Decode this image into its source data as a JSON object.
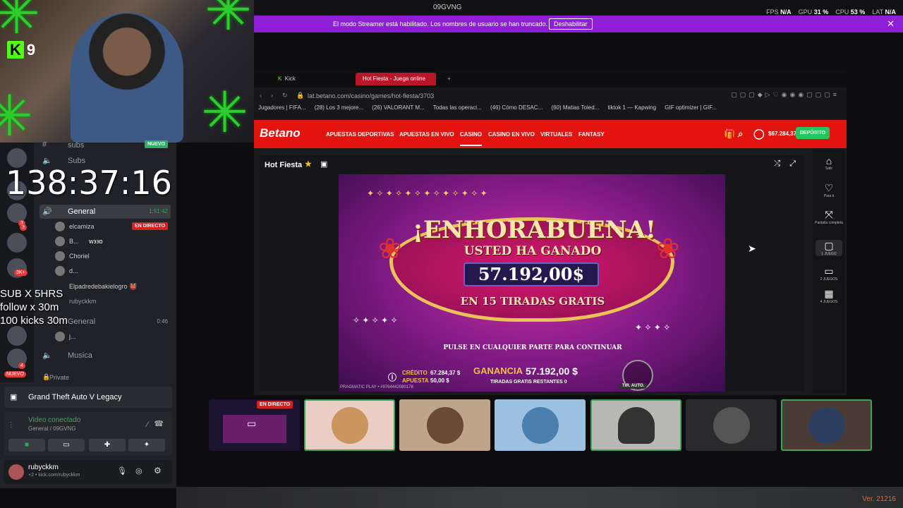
{
  "topbar": {
    "center_title": "09GVNG",
    "fps_label": "FPS",
    "fps_value": "N/A",
    "gpu_label": "GPU",
    "gpu_value": "31 %",
    "cpu_label": "CPU",
    "cpu_value": "53 %",
    "lat_label": "LAT",
    "lat_value": "N/A"
  },
  "streamer_bar": {
    "message": "El modo Streamer está habilitado. Los nombres de usuario se han truncado.",
    "button": "Deshabilitar",
    "close": "✕"
  },
  "webcam": {
    "kick_count": "9"
  },
  "overlay": {
    "timer": "138:37:16",
    "lines": [
      "SUB X 5HRS",
      "follow x 30m",
      "100 kicks 30m"
    ]
  },
  "discord": {
    "server_badges": [
      "3",
      "3K+",
      "NUEVO",
      "3",
      "4"
    ],
    "channels": [
      {
        "name": "subs",
        "badge": "NUEVO"
      },
      {
        "name": "Subs"
      },
      {
        "name": "General",
        "time": "1:51:42"
      }
    ],
    "members": [
      {
        "name": "elcamiza",
        "live": "EN DIRECTO"
      },
      {
        "name": "B...",
        "extra": "w϶϶ɒ"
      },
      {
        "name": "Choriel"
      },
      {
        "name": "d..."
      },
      {
        "name": "Elpadredebakielogro 👹"
      },
      {
        "name": "rubyckkm"
      }
    ],
    "channel_general2": {
      "name": "General",
      "time": "0:46"
    },
    "member_j": "j...",
    "channel_musica": "Musica",
    "private": "Private",
    "game_activity": "Grand Theft Auto V Legacy",
    "voice": {
      "status": "Video conectado",
      "sub": "General / 09GVNG"
    },
    "user": {
      "name": "rubyckkm",
      "sub": "+2 • kick.com/rubyckkm"
    }
  },
  "browser": {
    "tabs": [
      {
        "label": "Kick"
      },
      {
        "label": "Hot Fiesta - Juega online"
      }
    ],
    "url": "lat.betano.com/casino/games/hot-fiesta/3703",
    "bookmarks": [
      "Jugadores | FIFA...",
      "(28) Los 3 mejore...",
      "(26) VALORANT M...",
      "Todas las operaci...",
      "(46) Cómo DESAC...",
      "(60) Matias Toled...",
      "tiktok 1 — Kapwing",
      "GIF optimizer | GIF..."
    ]
  },
  "betano": {
    "logo": "Betano",
    "nav": [
      "APUESTAS DEPORTIVAS",
      "APUESTAS EN VIVO",
      "CASINO",
      "CASINO EN VIVO",
      "VIRTUALES",
      "FANTASY"
    ],
    "active_nav": "CASINO",
    "balance": "$67.284,37",
    "deposit": "DEPÓSITO"
  },
  "game": {
    "title": "Hot Fiesta",
    "headline": "¡ENHORABUENA!",
    "won_label": "USTED HA GANADO",
    "amount": "57.192,00$",
    "free_spins": "EN 15 TIRADAS GRATIS",
    "continue": "PULSE EN CUALQUIER PARTE PARA CONTINUAR",
    "credit_label": "CRÉDITO",
    "credit_value": "67.284,37 $",
    "bet_label": "APUESTA",
    "bet_value": "50,00 $",
    "win_label": "GANANCIA",
    "win_value": "57.192,00 $",
    "spins_left": "TIRADAS GRATIS RESTANTES 0",
    "provider": "PRAGMATIC PLAY • #9764442080178",
    "auto": "TIR. AUTO."
  },
  "side_panel": [
    {
      "icon": "home-icon",
      "label": "Salir"
    },
    {
      "icon": "heart-icon",
      "label": "Para ti"
    },
    {
      "icon": "fullscreen-icon",
      "label": "Pantalla completa"
    },
    {
      "icon": "one-game-icon",
      "label": "1 JUEGO"
    },
    {
      "icon": "two-games-icon",
      "label": "2 JUEGOS"
    },
    {
      "icon": "four-games-icon",
      "label": "4 JUEGOS"
    }
  ],
  "participants": {
    "live_label": "EN DIRECTO"
  },
  "version": "Ver. 21216",
  "colors": {
    "kick_green": "#53fc18",
    "streamer_purple": "#8e1fd6",
    "betano_red": "#e3140f",
    "deposit_green": "#22c55e",
    "live_red": "#d61f1f"
  }
}
